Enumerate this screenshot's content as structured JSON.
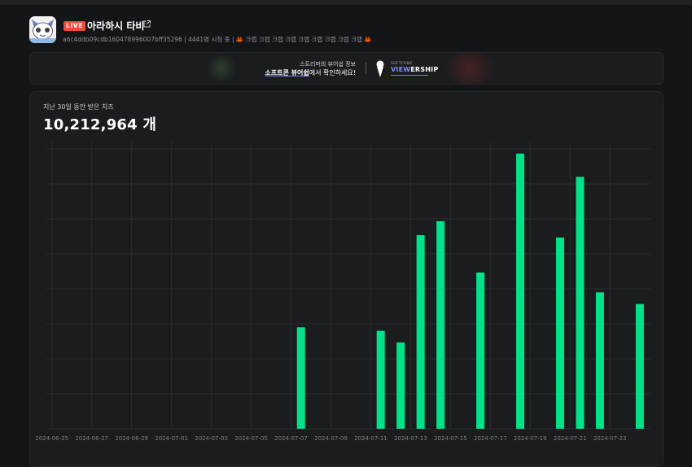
{
  "channel": {
    "live_badge": "LIVE",
    "name": "아라하시 타비",
    "meta_id": "a6c4ddb09cdb160478996007bff35296",
    "viewers_text": "4441명 시청 중",
    "crab_text": "크랩 크랩 크랩 크랩 크랩 크랩 크랩 크랩 크랩",
    "accent_color": "#ef4a3d"
  },
  "banner": {
    "line1": "스트리머의 뷰어쉽 정보",
    "line2_bold": "소프트콘 뷰어쉽",
    "line2_rest": "에서 확인하세요!",
    "brand_small": "SOFTCONE",
    "brand_view": "VIEW",
    "brand_ership": "ERSHIP"
  },
  "summary": {
    "subtitle": "지난 30일 동안 받은 치즈",
    "total": "10,212,964 개"
  },
  "chart_data": {
    "type": "bar",
    "color": "#00e28a",
    "categories": [
      "2024-06-25",
      "2024-06-26",
      "2024-06-27",
      "2024-06-28",
      "2024-06-29",
      "2024-06-30",
      "2024-07-01",
      "2024-07-02",
      "2024-07-03",
      "2024-07-04",
      "2024-07-05",
      "2024-07-06",
      "2024-07-07",
      "2024-07-08",
      "2024-07-09",
      "2024-07-10",
      "2024-07-11",
      "2024-07-12",
      "2024-07-13",
      "2024-07-14",
      "2024-07-15",
      "2024-07-16",
      "2024-07-17",
      "2024-07-18",
      "2024-07-19",
      "2024-07-20",
      "2024-07-21",
      "2024-07-22",
      "2024-07-23",
      "2024-07-24"
    ],
    "tick_labels": [
      "2024-06-25",
      "2024-06-27",
      "2024-06-29",
      "2024-07-01",
      "2024-07-03",
      "2024-07-05",
      "2024-07-07",
      "2024-07-09",
      "2024-07-11",
      "2024-07-13",
      "2024-07-15",
      "2024-07-17",
      "2024-07-19",
      "2024-07-21",
      "2024-07-23"
    ],
    "values": [
      0,
      0,
      0,
      0,
      0,
      0,
      0,
      0,
      0,
      0,
      0,
      0,
      435000,
      0,
      0,
      0,
      420000,
      370000,
      830000,
      890000,
      0,
      670000,
      0,
      1180000,
      0,
      820000,
      1080000,
      585000,
      0,
      535000
    ],
    "ylim": [
      0,
      1200000
    ],
    "grid": true,
    "legend": "none"
  }
}
